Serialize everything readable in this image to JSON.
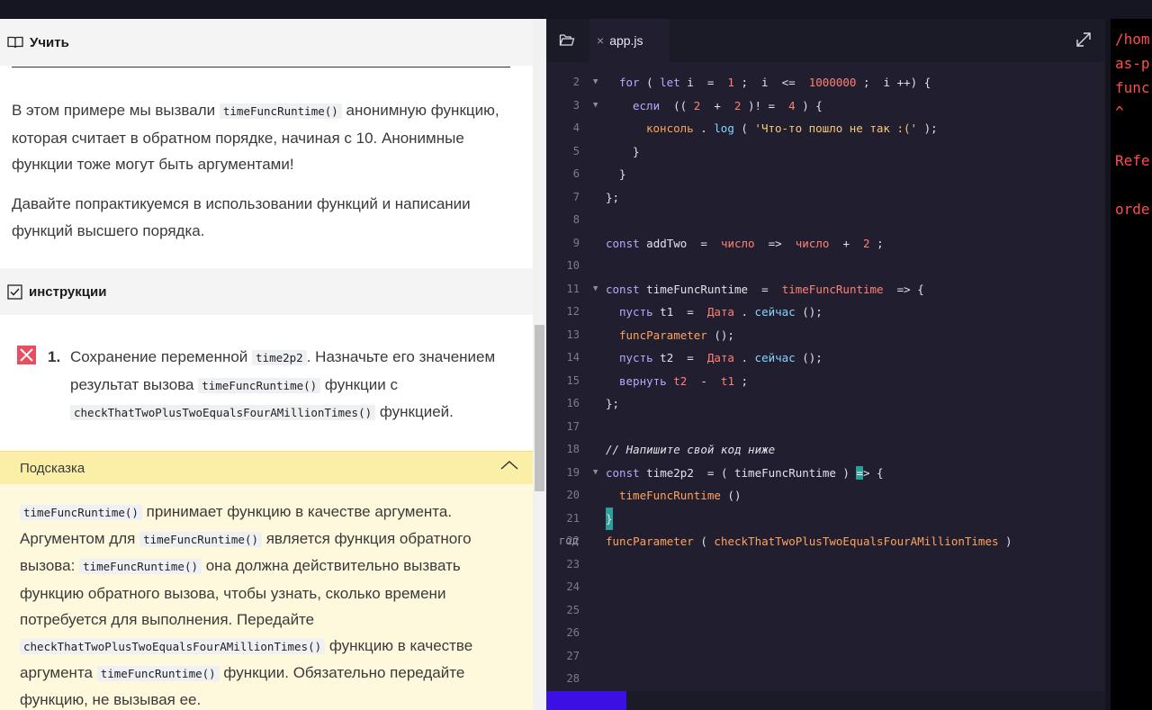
{
  "learn": {
    "header": "Учить",
    "para1_a": "В этом примере мы вызвали ",
    "para1_code": "timeFuncRuntime()",
    "para1_b": " анонимную функцию, которая считает в обратном порядке, начиная с 10. Анонимные функции тоже могут быть аргументами!",
    "para2": "Давайте попрактикуемся в использовании функций и написании функций высшего порядка.",
    "instructions_header": "инструкции",
    "task_number": "1.",
    "task_a": "Сохранение переменной ",
    "task_code1": "time2p2",
    "task_b": ". Назначьте его значением результат вызова ",
    "task_code2": "timeFuncRuntime()",
    "task_c": " функции с ",
    "task_code3": "checkThatTwoPlusTwoEqualsFourAMillionTimes()",
    "task_d": " функцией.",
    "hint_header": "Подсказка",
    "hint_code1": "timeFuncRuntime()",
    "hint_a": " принимает функцию в качестве аргумента. Аргументом для ",
    "hint_code2": "timeFuncRuntime()",
    "hint_b": " является функция обратного вызова: ",
    "hint_code3": "timeFuncRuntime()",
    "hint_c": " она должна действительно вызвать функцию обратного вызова, чтобы узнать, сколько времени потребуется для выполнения. Передайте ",
    "hint_code4": "checkThatTwoPlusTwoEqualsFourAMillionTimes()",
    "hint_d": " функцию в качестве аргумента ",
    "hint_code5": "timeFuncRuntime()",
    "hint_e": " функции. Обязательно передайте функцию, не вызывая ее."
  },
  "editor": {
    "tab_close": "×",
    "tab_name": "app.js",
    "line_numbers": [
      "2",
      "3",
      "4",
      "5",
      "6",
      "7",
      "8",
      "9",
      "10",
      "11",
      "12",
      "13",
      "14",
      "15",
      "16",
      "17",
      "18",
      "19",
      "20",
      "21",
      "22",
      "23",
      "24",
      "25",
      "26",
      "27",
      "28"
    ],
    "line22_prefix": "год",
    "tokens": {
      "l2": [
        "for",
        " ( ",
        "let",
        " i  =  ",
        "1",
        " ;  i  <=  ",
        "1000000",
        " ;  i ++) {"
      ],
      "l3": [
        "если",
        "  (( ",
        "2",
        "  +  ",
        "2",
        " )! =  ",
        "4",
        " ) {"
      ],
      "l4": [
        "консоль",
        " . ",
        "log",
        " ( ",
        "'Что-то пошло не так :('",
        " );"
      ],
      "l5": "}",
      "l6": "}",
      "l7": "};",
      "l9": [
        "const",
        " addTwo  =  ",
        "число",
        "  =>  ",
        "число",
        "  +  ",
        "2",
        " ;"
      ],
      "l11": [
        "const",
        " timeFuncRuntime  =  ",
        "timeFuncRuntime",
        "  => {"
      ],
      "l12": [
        "пусть",
        " t1  =  ",
        "Дата",
        " . ",
        "сейчас",
        " ();"
      ],
      "l13": [
        "funcParameter",
        " ();"
      ],
      "l14": [
        "пусть",
        " t2  =  ",
        "Дата",
        " . ",
        "сейчас",
        " ();"
      ],
      "l15": [
        "вернуть",
        " ",
        "t2",
        "  -  ",
        "t1",
        " ;"
      ],
      "l16": "};",
      "l18": "// Напишите свой код ниже",
      "l19": [
        "const",
        " time2p2  = ( timeFuncRuntime ) ",
        "=",
        "> {"
      ],
      "l20": [
        "timeFuncRuntime",
        " ()"
      ],
      "l21": "}",
      "l22": [
        "funcParameter",
        " ( ",
        "checkThatTwoPlusTwoEqualsFourAMillionTimes",
        " )"
      ]
    }
  },
  "terminal": {
    "lines": [
      "/hom",
      "as-p",
      "func",
      "^",
      "",
      "Refe",
      "",
      "orde"
    ]
  },
  "colors": {
    "editor_bg": "#211e2f",
    "keyword": "#b6a9ff",
    "number": "#ff8173",
    "string": "#f6cb7a",
    "function": "#ffa35c",
    "property": "#84d6ff",
    "error": "#ff4d4d",
    "run_button": "#3a10e5",
    "fail_badge": "#e94d5f",
    "hint_bg": "#fef9dc"
  },
  "icons": [
    "book-icon",
    "checkbox-icon",
    "fail-x-icon",
    "chevron-up-icon",
    "folder-icon",
    "expand-icon",
    "close-icon"
  ]
}
